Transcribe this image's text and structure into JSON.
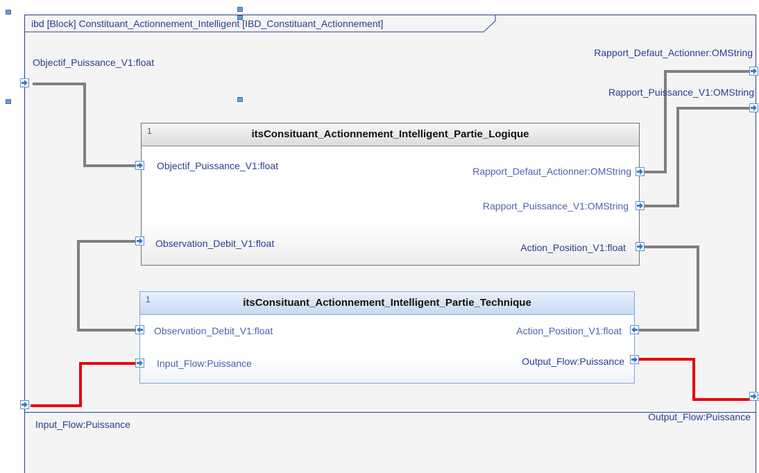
{
  "diagram": {
    "title": "ibd [Block] Constituant_Actionnement_Intelligent [IBD_Constituant_Actionnement]",
    "colors": {
      "frame": "#2a3d8f",
      "port_border": "#5a8fd0",
      "connector": "#7f7f7f",
      "flow_connector": "#e8000b"
    }
  },
  "boundary_ports": {
    "objectif": "Objectif_Puissance_V1:float",
    "rapport_defaut": "Rapport_Defaut_Actionner:OMString",
    "rapport_puissance": "Rapport_Puissance_V1:OMString",
    "input_flow": "Input_Flow:Puissance",
    "output_flow": "Output_Flow:Puissance"
  },
  "blocks": {
    "logique": {
      "multiplicity": "1",
      "name": "itsConsituant_Actionnement_Intelligent_Partie_Logique",
      "ports": {
        "objectif": "Objectif_Puissance_V1:float",
        "observation": "Observation_Debit_V1:float",
        "rapport_defaut": "Rapport_Defaut_Actionner:OMString",
        "rapport_puissance": "Rapport_Puissance_V1:OMString",
        "action": "Action_Position_V1:float"
      }
    },
    "technique": {
      "multiplicity": "1",
      "name": "itsConsituant_Actionnement_Intelligent_Partie_Technique",
      "ports": {
        "observation": "Observation_Debit_V1:float",
        "input_flow": "Input_Flow:Puissance",
        "action": "Action_Position_V1:float",
        "output_flow": "Output_Flow:Puissance"
      }
    }
  }
}
